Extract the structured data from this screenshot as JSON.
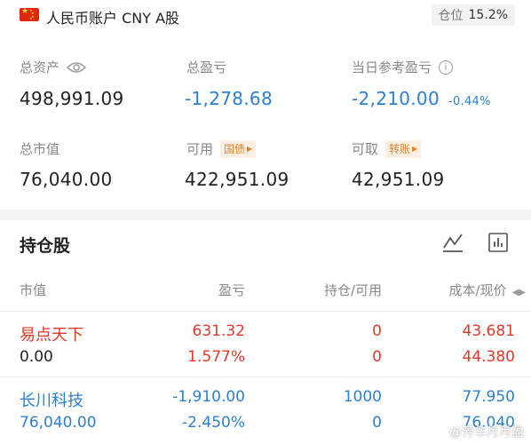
{
  "account": {
    "name": "人民币账户 CNY A股",
    "position_label": "仓位",
    "position_value": "15.2%"
  },
  "metrics": {
    "total_assets_label": "总资产",
    "total_assets_value": "498,991.09",
    "total_pnl_label": "总盈亏",
    "total_pnl_value": "-1,278.68",
    "daily_pnl_label": "当日参考盈亏",
    "daily_pnl_value": "-2,210.00",
    "daily_pnl_pct": "-0.44%",
    "market_value_label": "总市值",
    "market_value_value": "76,040.00",
    "available_label": "可用",
    "available_tag": "国债",
    "available_value": "422,951.09",
    "withdrawable_label": "可取",
    "withdrawable_tag": "转账",
    "withdrawable_value": "42,951.09"
  },
  "holdings": {
    "title": "持仓股",
    "columns": [
      "市值",
      "盈亏",
      "持仓/可用",
      "成本/现价"
    ],
    "rows": [
      {
        "name": "易点天下",
        "market_value": "0.00",
        "pnl": "631.32",
        "pnl_pct": "1.577%",
        "position": "0",
        "available": "0",
        "cost": "43.681",
        "price": "44.380"
      },
      {
        "name": "长川科技",
        "market_value": "76,040.00",
        "pnl": "-1,910.00",
        "pnl_pct": "-2.450%",
        "position": "1000",
        "available": "0",
        "cost": "77.950",
        "price": "76.040"
      }
    ]
  },
  "watermark": "@芳华月月盈",
  "icons": [
    "flag-cn-icon",
    "eye-icon",
    "info-icon",
    "chart-line-icon",
    "chart-bar-icon",
    "sort-icon"
  ],
  "colors": {
    "negative": "#2d7fd3",
    "positive": "#e23a2a",
    "tag_bg": "#fdf0e3",
    "tag_fg": "#e6812a"
  }
}
